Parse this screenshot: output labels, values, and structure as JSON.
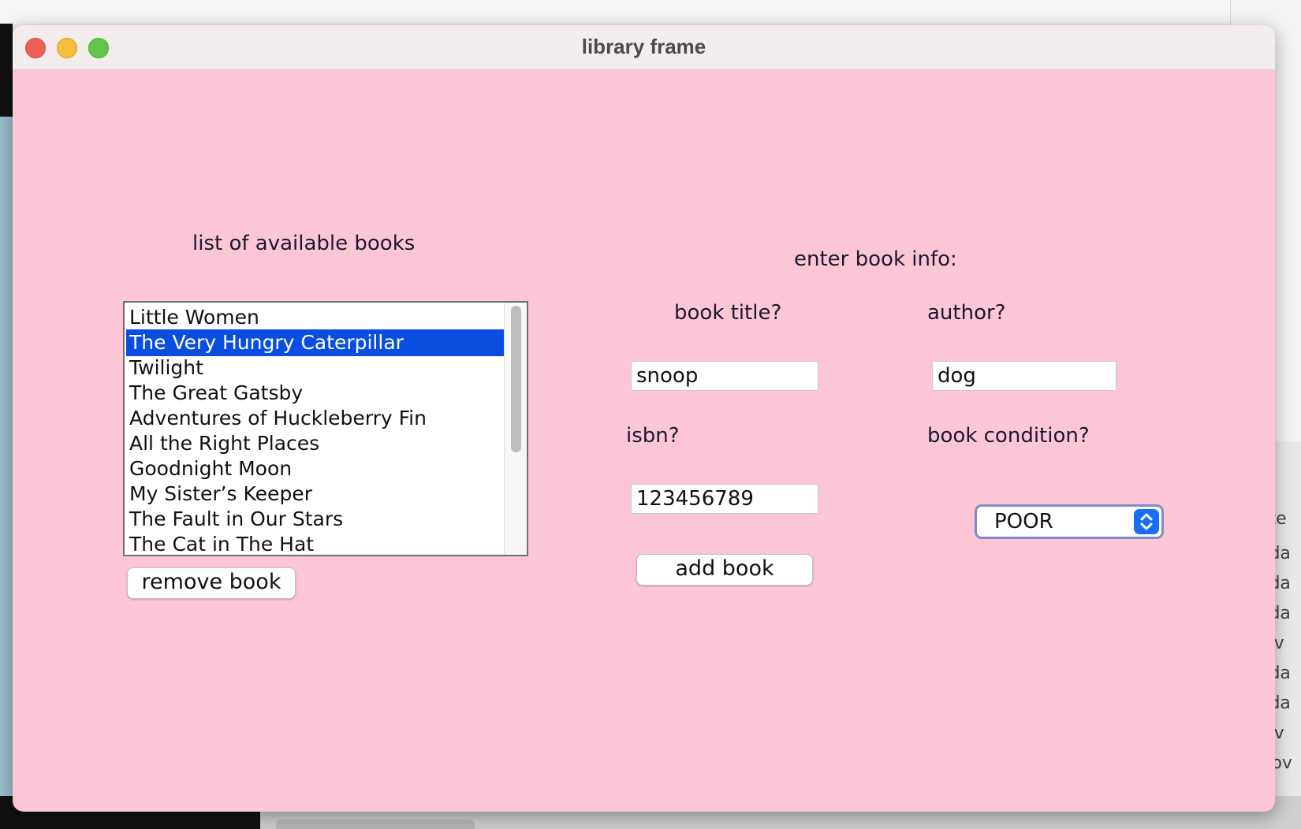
{
  "window": {
    "title": "library frame"
  },
  "list_section": {
    "heading": "list of available books",
    "books": [
      "Little Women",
      "The Very Hungry Caterpillar",
      "Twilight",
      "The Great Gatsby",
      "Adventures of Huckleberry Fin",
      "All the Right Places",
      "Goodnight Moon",
      "My Sister’s Keeper",
      "The Fault in Our Stars",
      "The Cat in The Hat"
    ],
    "selected_book": "The Very Hungry Caterpillar",
    "remove_button": "remove book"
  },
  "form": {
    "heading": "enter book info:",
    "title_label": "book title?",
    "title_value": "snoop",
    "author_label": "author?",
    "author_value": "dog",
    "isbn_label": "isbn?",
    "isbn_value": "123456789",
    "condition_label": "book condition?",
    "condition_value": "POOR",
    "add_button": "add book"
  },
  "background_window": {
    "column_header": "ate",
    "rows": [
      "oda",
      "oda",
      "oda",
      "lov",
      "oda",
      "oda",
      "lov",
      "Nov"
    ]
  },
  "colors": {
    "window_bg": "#fdc6d7",
    "selection": "#0a4ee0",
    "select_accent": "#1a6ef5"
  }
}
